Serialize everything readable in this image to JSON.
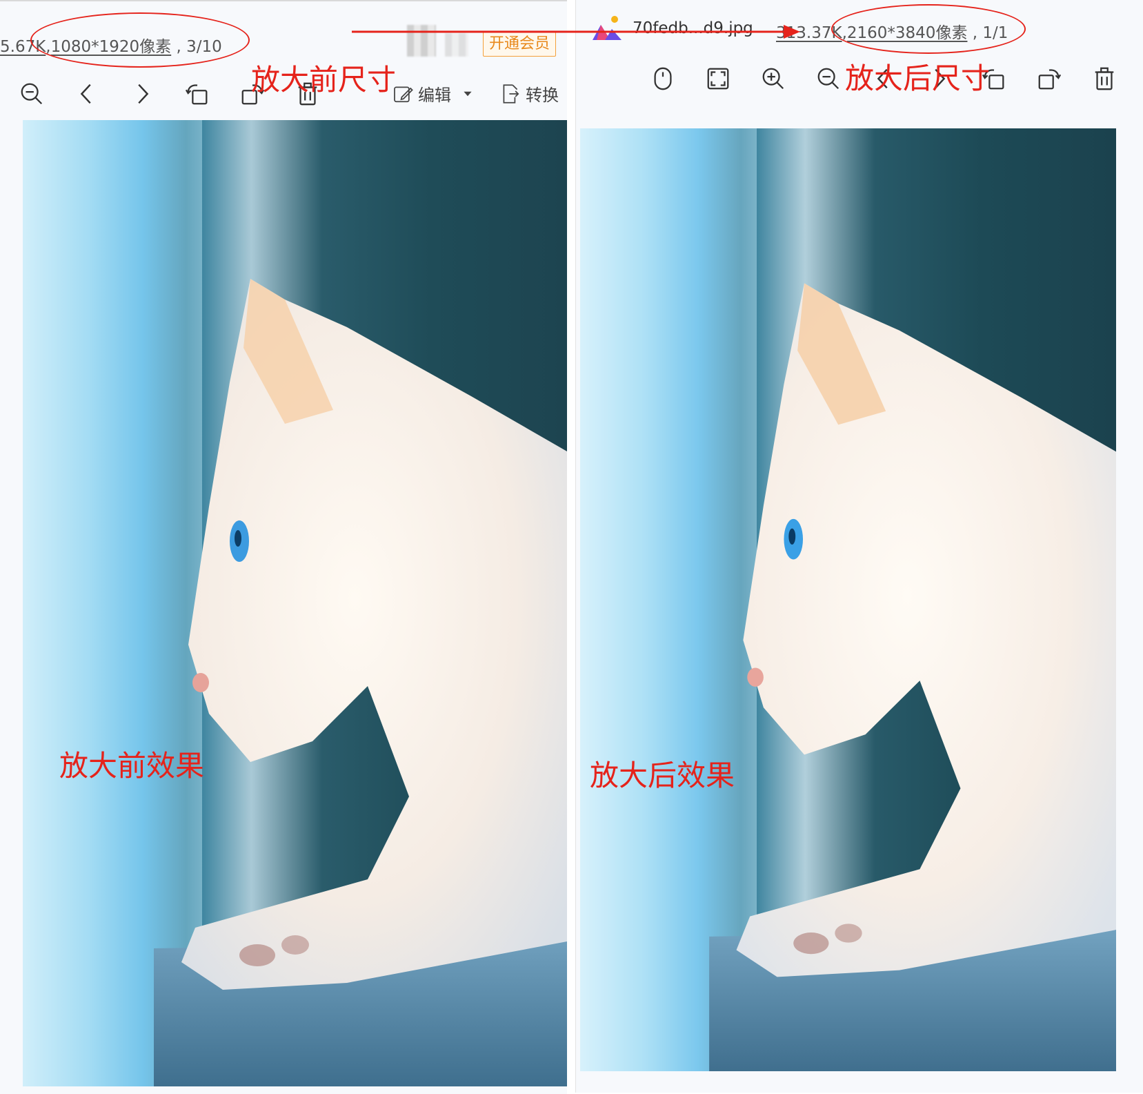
{
  "left": {
    "size_text": "5.67K",
    "resolution_text": "1080*1920像素",
    "page_text": ", 3/10",
    "vip_label": "开通会员",
    "toolbar": {
      "edit_label": "编辑",
      "convert_label": "转换"
    },
    "annotation_size": "放大前尺寸",
    "annotation_effect": "放大前效果"
  },
  "right": {
    "filename": "70fedb...d9.jpg",
    "size_text": "313.37K",
    "resolution_text": "2160*3840像素",
    "page_text": ", 1/1",
    "annotation_size": "放大后尺寸",
    "annotation_effect": "放大后效果"
  },
  "colors": {
    "annotation_red": "#e5231b",
    "vip_orange": "#e8891c"
  }
}
